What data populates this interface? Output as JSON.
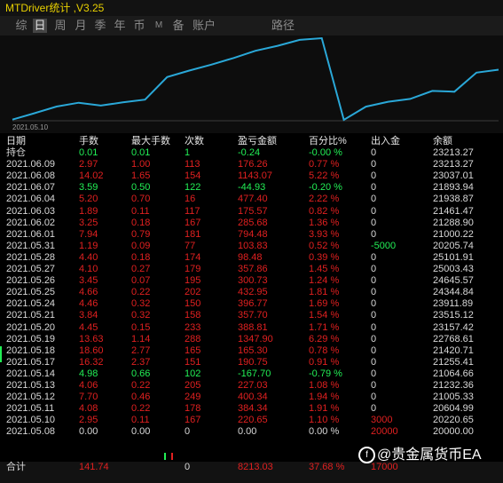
{
  "title": "MTDriver统计 ,V3.25",
  "tabs": [
    {
      "label": "综"
    },
    {
      "label": "日"
    },
    {
      "label": "周"
    },
    {
      "label": "月"
    },
    {
      "label": "季"
    },
    {
      "label": "年"
    },
    {
      "label": "币"
    },
    {
      "label": "M"
    },
    {
      "label": "备"
    },
    {
      "label": "账户"
    },
    {
      "label": "路径"
    }
  ],
  "active_tab": "日",
  "chart": {
    "x_label": "2021.05.10",
    "line_color": "#2aa8d8",
    "values": [
      20220.65,
      20604.99,
      21005.33,
      21232.36,
      21064.66,
      21255.41,
      21420.71,
      22768.61,
      23157.42,
      23515.12,
      23911.89,
      24344.84,
      24645.57,
      25003.43,
      25101.91,
      20205.74,
      21000.22,
      21288.9,
      21461.47,
      21938.87,
      21893.94,
      23037.01,
      23213.27
    ]
  },
  "headers": [
    "日期",
    "手数",
    "最大手数",
    "次数",
    "盈亏金额",
    "百分比%",
    "出入金",
    "余额"
  ],
  "position_row": {
    "date": "持仓",
    "lots": "0.01",
    "max_lots": "0.01",
    "count": "1",
    "pnl": "-0.24",
    "pct": "-0.00 %",
    "inout": "0",
    "balance": "23213.27"
  },
  "rows": [
    {
      "date": "2021.06.09",
      "lots": "2.97",
      "max_lots": "1.00",
      "count": "113",
      "pnl": "176.26",
      "pct": "0.77 %",
      "inout": "0",
      "balance": "23213.27",
      "color": "red"
    },
    {
      "date": "2021.06.08",
      "lots": "14.02",
      "max_lots": "1.65",
      "count": "154",
      "pnl": "1143.07",
      "pct": "5.22 %",
      "inout": "0",
      "balance": "23037.01",
      "color": "red"
    },
    {
      "date": "2021.06.07",
      "lots": "3.59",
      "max_lots": "0.50",
      "count": "122",
      "pnl": "-44.93",
      "pct": "-0.20 %",
      "inout": "0",
      "balance": "21893.94",
      "color": "green"
    },
    {
      "date": "2021.06.04",
      "lots": "5.20",
      "max_lots": "0.70",
      "count": "16",
      "pnl": "477.40",
      "pct": "2.22 %",
      "inout": "0",
      "balance": "21938.87",
      "color": "red"
    },
    {
      "date": "2021.06.03",
      "lots": "1.89",
      "max_lots": "0.11",
      "count": "117",
      "pnl": "175.57",
      "pct": "0.82 %",
      "inout": "0",
      "balance": "21461.47",
      "color": "red"
    },
    {
      "date": "2021.06.02",
      "lots": "3.25",
      "max_lots": "0.18",
      "count": "167",
      "pnl": "285.68",
      "pct": "1.36 %",
      "inout": "0",
      "balance": "21288.90",
      "color": "red"
    },
    {
      "date": "2021.06.01",
      "lots": "7.94",
      "max_lots": "0.79",
      "count": "181",
      "pnl": "794.48",
      "pct": "3.93 %",
      "inout": "0",
      "balance": "21000.22",
      "color": "red"
    },
    {
      "date": "2021.05.31",
      "lots": "1.19",
      "max_lots": "0.09",
      "count": "77",
      "pnl": "103.83",
      "pct": "0.52 %",
      "inout": "-5000",
      "balance": "20205.74",
      "color": "red"
    },
    {
      "date": "2021.05.28",
      "lots": "4.40",
      "max_lots": "0.18",
      "count": "174",
      "pnl": "98.48",
      "pct": "0.39 %",
      "inout": "0",
      "balance": "25101.91",
      "color": "red"
    },
    {
      "date": "2021.05.27",
      "lots": "4.10",
      "max_lots": "0.27",
      "count": "179",
      "pnl": "357.86",
      "pct": "1.45 %",
      "inout": "0",
      "balance": "25003.43",
      "color": "red"
    },
    {
      "date": "2021.05.26",
      "lots": "3.45",
      "max_lots": "0.07",
      "count": "195",
      "pnl": "300.73",
      "pct": "1.24 %",
      "inout": "0",
      "balance": "24645.57",
      "color": "red"
    },
    {
      "date": "2021.05.25",
      "lots": "4.66",
      "max_lots": "0.22",
      "count": "202",
      "pnl": "432.95",
      "pct": "1.81 %",
      "inout": "0",
      "balance": "24344.84",
      "color": "red"
    },
    {
      "date": "2021.05.24",
      "lots": "4.46",
      "max_lots": "0.32",
      "count": "150",
      "pnl": "396.77",
      "pct": "1.69 %",
      "inout": "0",
      "balance": "23911.89",
      "color": "red"
    },
    {
      "date": "2021.05.21",
      "lots": "3.84",
      "max_lots": "0.32",
      "count": "158",
      "pnl": "357.70",
      "pct": "1.54 %",
      "inout": "0",
      "balance": "23515.12",
      "color": "red"
    },
    {
      "date": "2021.05.20",
      "lots": "4.45",
      "max_lots": "0.15",
      "count": "233",
      "pnl": "388.81",
      "pct": "1.71 %",
      "inout": "0",
      "balance": "23157.42",
      "color": "red"
    },
    {
      "date": "2021.05.19",
      "lots": "13.63",
      "max_lots": "1.14",
      "count": "288",
      "pnl": "1347.90",
      "pct": "6.29 %",
      "inout": "0",
      "balance": "22768.61",
      "color": "red"
    },
    {
      "date": "2021.05.18",
      "lots": "18.60",
      "max_lots": "2.77",
      "count": "165",
      "pnl": "165.30",
      "pct": "0.78 %",
      "inout": "0",
      "balance": "21420.71",
      "color": "red"
    },
    {
      "date": "2021.05.17",
      "lots": "16.32",
      "max_lots": "2.37",
      "count": "151",
      "pnl": "190.75",
      "pct": "0.91 %",
      "inout": "0",
      "balance": "21255.41",
      "color": "red"
    },
    {
      "date": "2021.05.14",
      "lots": "4.98",
      "max_lots": "0.66",
      "count": "102",
      "pnl": "-167.70",
      "pct": "-0.79 %",
      "inout": "0",
      "balance": "21064.66",
      "color": "green"
    },
    {
      "date": "2021.05.13",
      "lots": "4.06",
      "max_lots": "0.22",
      "count": "205",
      "pnl": "227.03",
      "pct": "1.08 %",
      "inout": "0",
      "balance": "21232.36",
      "color": "red"
    },
    {
      "date": "2021.05.12",
      "lots": "7.70",
      "max_lots": "0.46",
      "count": "249",
      "pnl": "400.34",
      "pct": "1.94 %",
      "inout": "0",
      "balance": "21005.33",
      "color": "red"
    },
    {
      "date": "2021.05.11",
      "lots": "4.08",
      "max_lots": "0.22",
      "count": "178",
      "pnl": "384.34",
      "pct": "1.91 %",
      "inout": "0",
      "balance": "20604.99",
      "color": "red"
    },
    {
      "date": "2021.05.10",
      "lots": "2.95",
      "max_lots": "0.11",
      "count": "167",
      "pnl": "220.65",
      "pct": "1.10 %",
      "inout": "3000",
      "balance": "20220.65",
      "color": "red"
    },
    {
      "date": "2021.05.08",
      "lots": "0.00",
      "max_lots": "0.00",
      "count": "0",
      "pnl": "0.00",
      "pct": "0.00 %",
      "inout": "20000",
      "balance": "20000.00",
      "color": "white"
    }
  ],
  "total": {
    "label": "合计",
    "lots": "141.74",
    "max_lots": "",
    "count": "0",
    "pnl": "8213.03",
    "pct": "37.68 %",
    "inout": "17000"
  },
  "watermark": "@贵金属货币EA"
}
